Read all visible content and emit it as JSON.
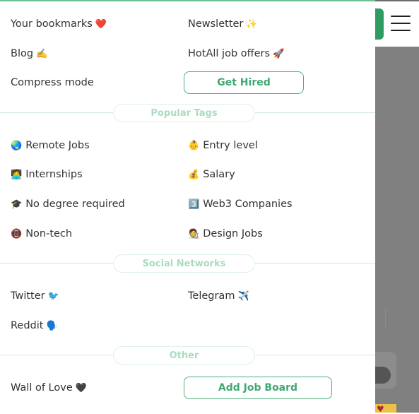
{
  "menu": {
    "top": {
      "bookmarks": {
        "label": "Your bookmarks",
        "emoji": "❤️"
      },
      "newsletter": {
        "label": "Newsletter",
        "emoji": "✨"
      },
      "blog": {
        "label": "Blog",
        "emoji": "✍️"
      },
      "job_offers": {
        "label": "HotAll job offers",
        "emoji": "🚀"
      },
      "compress": {
        "label": "Compress mode"
      },
      "get_hired": {
        "label": "Get Hired"
      }
    },
    "popular_tags": {
      "heading": "Popular Tags",
      "items": [
        {
          "emoji": "🌏",
          "label": "Remote Jobs"
        },
        {
          "emoji": "👶",
          "label": "Entry level"
        },
        {
          "emoji": "🧑‍💻",
          "label": "Internships"
        },
        {
          "emoji": "💰",
          "label": "Salary"
        },
        {
          "emoji": "🎓",
          "label": "No degree required"
        },
        {
          "emoji": "3️⃣",
          "label": "Web3 Companies"
        },
        {
          "emoji": "📵",
          "label": "Non-tech"
        },
        {
          "emoji": "🧑‍🎨",
          "label": "Design Jobs"
        }
      ]
    },
    "social_networks": {
      "heading": "Social Networks",
      "items": [
        {
          "label": "Twitter",
          "emoji": "🐦"
        },
        {
          "label": "Telegram",
          "emoji": "✈️"
        },
        {
          "label": "Reddit",
          "emoji": "🗣️"
        }
      ]
    },
    "other": {
      "heading": "Other",
      "wall_of_love": {
        "label": "Wall of Love",
        "emoji": "🖤"
      },
      "add_job_board": {
        "label": "Add Job Board"
      }
    }
  },
  "colors": {
    "accent": "#3fa872",
    "accent_border": "#4caf7a",
    "divider": "#cfeadb",
    "pill_text": "#a9dcc0"
  }
}
